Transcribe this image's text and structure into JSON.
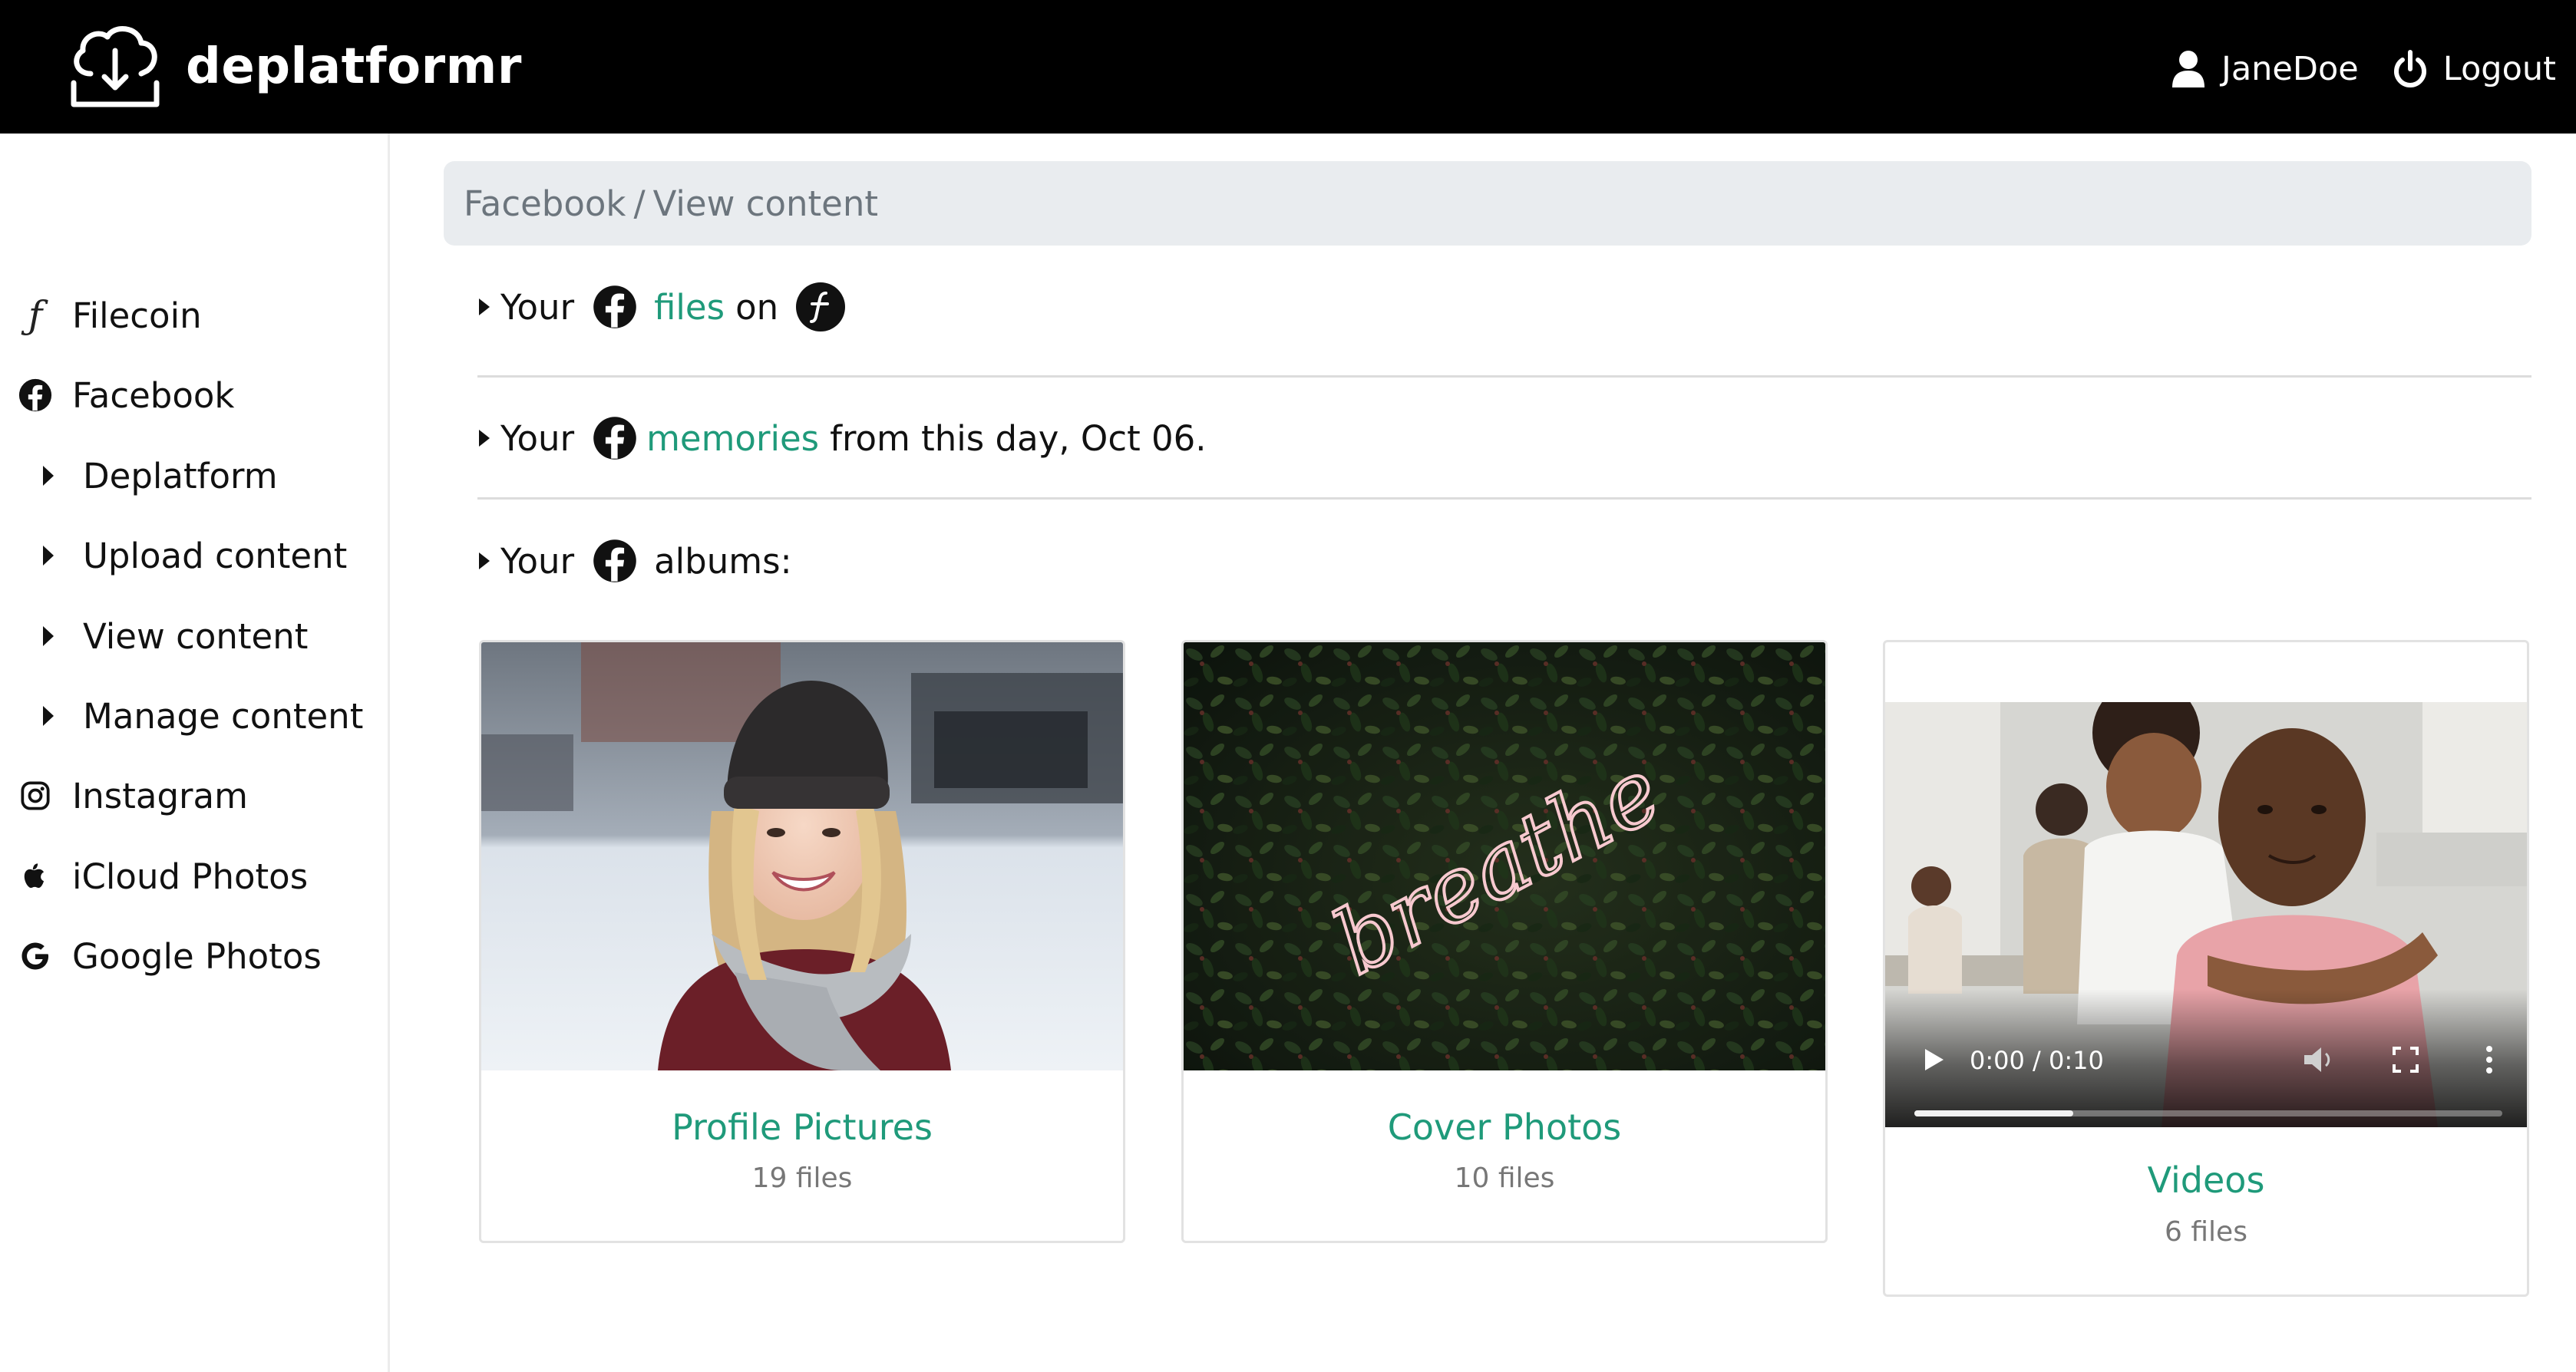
{
  "app": {
    "name": "deplatformr",
    "user": "JaneDoe",
    "logout_label": "Logout"
  },
  "sidebar": {
    "items": [
      {
        "label": "Filecoin",
        "icon": "filecoin-icon"
      },
      {
        "label": "Facebook",
        "icon": "facebook-icon"
      },
      {
        "label": "Deplatform",
        "icon": "caret-right-icon"
      },
      {
        "label": "Upload content",
        "icon": "caret-right-icon"
      },
      {
        "label": "View content",
        "icon": "caret-right-icon"
      },
      {
        "label": "Manage content",
        "icon": "caret-right-icon"
      },
      {
        "label": "Instagram",
        "icon": "instagram-icon"
      },
      {
        "label": "iCloud Photos",
        "icon": "apple-icon"
      },
      {
        "label": "Google Photos",
        "icon": "google-icon"
      }
    ]
  },
  "breadcrumb": {
    "root": "Facebook",
    "separator": "/",
    "current": "View content"
  },
  "sections": {
    "files": {
      "prefix": "Your",
      "link": "files",
      "suffix": "on"
    },
    "memories": {
      "prefix": "Your",
      "link": "memories",
      "suffix": "from this day, Oct 06."
    },
    "albums": {
      "prefix": "Your",
      "suffix": "albums:"
    }
  },
  "albums": [
    {
      "title": "Profile Pictures",
      "count": "19 files"
    },
    {
      "title": "Cover Photos",
      "count": "10 files",
      "neon_text": "breathe"
    },
    {
      "title": "Videos",
      "count": "6 files"
    }
  ],
  "video": {
    "time": "0:00 / 0:10",
    "buffered_fraction": 0.27
  },
  "colors": {
    "accent": "#1f9a7a",
    "topbar": "#000000",
    "breadcrumb_bg": "#e9ecef"
  }
}
